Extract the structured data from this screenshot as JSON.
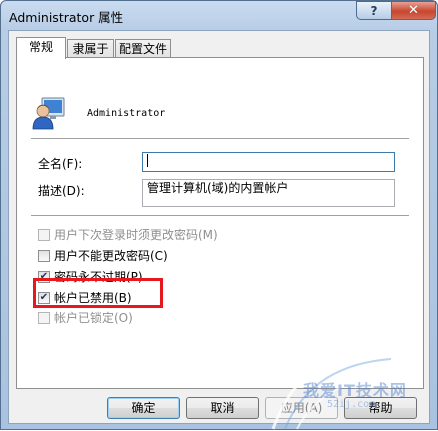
{
  "window": {
    "title": "Administrator 属性",
    "help_glyph": "?",
    "close_glyph": "✕"
  },
  "tabs": [
    {
      "label": "常规",
      "active": true
    },
    {
      "label": "隶属于",
      "active": false
    },
    {
      "label": "配置文件",
      "active": false
    }
  ],
  "user": {
    "name": "Administrator",
    "icon": "user-account-icon"
  },
  "fullname": {
    "label": "全名(F):",
    "value": ""
  },
  "description": {
    "label": "描述(D):",
    "value": "管理计算机(域)的内置帐户"
  },
  "checkboxes": [
    {
      "label": "用户下次登录时须更改密码(M)",
      "checked": false,
      "enabled": false
    },
    {
      "label": "用户不能更改密码(C)",
      "checked": false,
      "enabled": true
    },
    {
      "label": "密码永不过期(P)",
      "checked": true,
      "enabled": true
    },
    {
      "label": "帐户已禁用(B)",
      "checked": true,
      "enabled": true
    },
    {
      "label": "帐户已锁定(O)",
      "checked": false,
      "enabled": false
    }
  ],
  "buttons": {
    "ok": "确定",
    "cancel": "取消",
    "apply": "应用(A)",
    "help": "帮助"
  },
  "watermark": {
    "text": "我爱IT技术网",
    "sub": "52ij.com"
  },
  "colors": {
    "highlight": "#e6191f",
    "close": "#c7462f"
  }
}
